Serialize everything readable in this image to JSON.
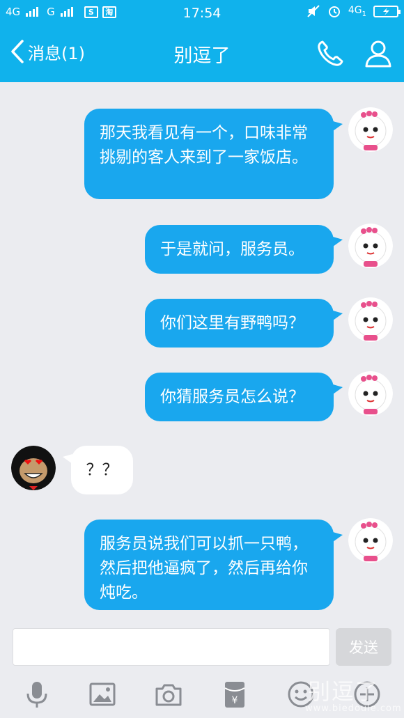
{
  "status_bar": {
    "network_1": "4G",
    "network_2": "G",
    "box_1": "S",
    "box_2": "淘",
    "time": "17:54",
    "network_right": "4G",
    "network_right_sub": "1"
  },
  "nav": {
    "back_label": "消息(1)",
    "title": "别逗了"
  },
  "messages": [
    {
      "side": "out",
      "text": "那天我看见有一个，口味非常挑剔的客人来到了一家饭店。"
    },
    {
      "side": "out",
      "text": "于是就问，服务员。"
    },
    {
      "side": "out",
      "text": "你们这里有野鸭吗？"
    },
    {
      "side": "out",
      "text": "你猜服务员怎么说？"
    },
    {
      "side": "in",
      "text": "？？"
    },
    {
      "side": "out",
      "text": "服务员说我们可以抓一只鸭，然后把他逼疯了，然后再给你炖吃。"
    }
  ],
  "input": {
    "value": "",
    "send_label": "发送"
  },
  "toolbar": {
    "icons": [
      "microphone-icon",
      "image-icon",
      "camera-icon",
      "red-packet-icon",
      "emoji-icon",
      "plus-icon"
    ]
  },
  "watermark": {
    "text": "别逗了",
    "url": "www.biedoule.com"
  },
  "colors": {
    "brand": "#10b2ec",
    "outgoing_bubble": "#19a7ee",
    "chat_background": "#ebecf0"
  }
}
